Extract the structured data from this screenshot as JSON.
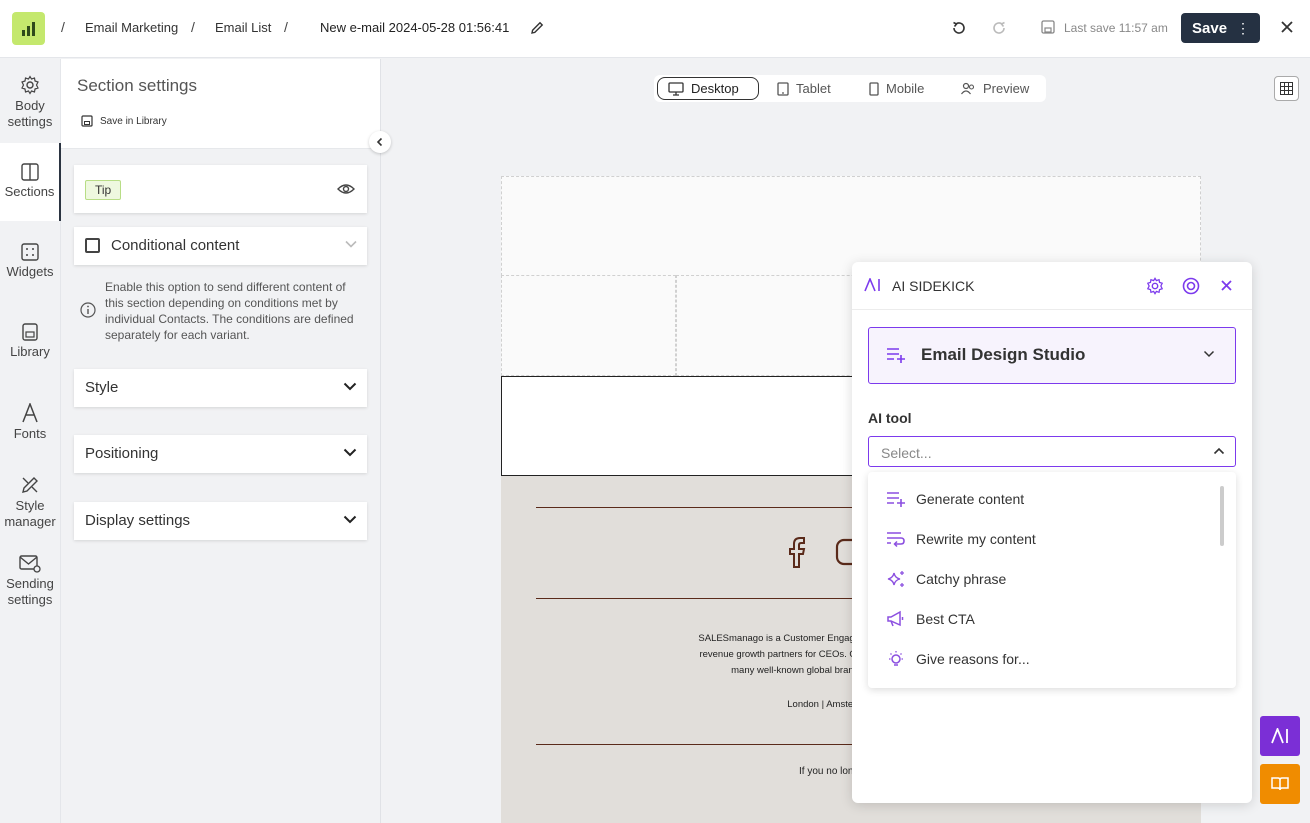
{
  "breadcrumb": {
    "items": [
      "Email Marketing",
      "Email List"
    ],
    "title": "New e-mail 2024-05-28 01:56:41",
    "separator": "/"
  },
  "toolbar": {
    "last_save": "Last save 11:57 am",
    "save_label": "Save"
  },
  "rail": {
    "body_settings": "Body settings",
    "sections": "Sections",
    "widgets": "Widgets",
    "library": "Library",
    "fonts": "Fonts",
    "style_manager": "Style manager",
    "sending_settings": "Sending settings"
  },
  "panel": {
    "title": "Section settings",
    "save_in_library": "Save in Library",
    "tip": "Tip",
    "conditional_label": "Conditional content",
    "conditional_desc": "Enable this option to send different content of this section depending on conditions met by individual Contacts. The conditions are defined separately for each variant.",
    "style": "Style",
    "positioning": "Positioning",
    "display_settings": "Display settings"
  },
  "devtabs": {
    "desktop": "Desktop",
    "tablet": "Tablet",
    "mobile": "Mobile",
    "preview": "Preview"
  },
  "email": {
    "footer_text": "SALESmanago is a Customer Engagement Platform for impact-hungry e… revenue growth partners for CEOs. Our AI-driven solutions have already … many well-known global brands such as Starbucks, Voda…",
    "footer_line1": "SALESmanago is a Customer Engagement Platform for impact-hungry e",
    "footer_line2": "revenue growth partners for CEOs. Our AI-driven solutions have already",
    "footer_line3": "many well-known global brands such as Starbucks, Voda",
    "cities": "London | Amsterdam | New Yo",
    "unsubscribe": "If you no longer want to"
  },
  "sidekick": {
    "title": "AI SIDEKICK",
    "studio": "Email Design Studio",
    "tool_label": "AI tool",
    "select_placeholder": "Select...",
    "options": [
      "Generate content",
      "Rewrite my content",
      "Catchy phrase",
      "Best CTA",
      "Give reasons for..."
    ]
  },
  "colors": {
    "accent": "#7c3aed",
    "save_button": "#253142",
    "logo": "#c4e86d",
    "ai_fab": "#7b2fd6",
    "book_fab": "#f08c00"
  }
}
